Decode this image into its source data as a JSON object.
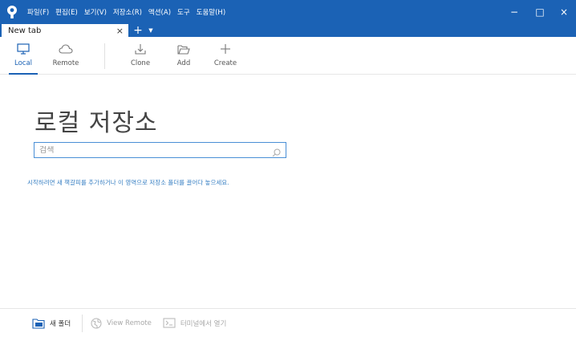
{
  "menu": {
    "items": [
      "파일(F)",
      "편집(E)",
      "보기(V)",
      "저장소(R)",
      "액션(A)",
      "도구",
      "도움말(H)"
    ]
  },
  "window": {
    "minimize": "−",
    "maximize": "□",
    "close": "×"
  },
  "tabs": {
    "active_label": "New tab",
    "close": "×",
    "add": "+",
    "dropdown": "▼"
  },
  "toolbar": {
    "local_label": "Local",
    "remote_label": "Remote",
    "clone_label": "Clone",
    "add_label": "Add",
    "create_label": "Create"
  },
  "main": {
    "title": "로컬 저장소",
    "search_placeholder": "검색",
    "hint": "시작하려면 새 책갈피를 추가하거나 이 영역으로 저장소 폴더를 끌어다 놓으세요."
  },
  "bottombar": {
    "new_folder": "새 폴더",
    "view_remote": "View Remote",
    "open_in_terminal": "터미널에서 열기"
  },
  "colors": {
    "accent": "#1b62b5",
    "link": "#3b82c4"
  }
}
